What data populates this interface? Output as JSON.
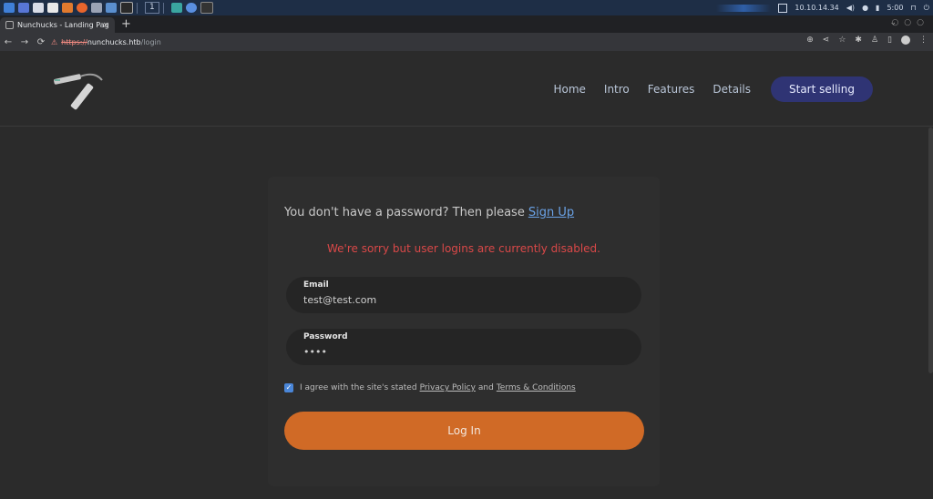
{
  "os_taskbar": {
    "workspace_number": "1",
    "status_text": "10.10.14.34",
    "clock": "5:00",
    "colors": {
      "bar": "#1e2e46"
    }
  },
  "browser": {
    "tab_title": "Nunchucks - Landing Pag",
    "tab_close": "×",
    "new_tab": "+",
    "url_scheme": "https://",
    "url_host": "nunchucks.htb",
    "url_path": "/login",
    "nav_back": "←",
    "nav_forward": "→",
    "nav_reload": "⟳"
  },
  "site": {
    "nav": {
      "home": "Home",
      "intro": "Intro",
      "features": "Features",
      "details": "Details",
      "cta": "Start selling"
    },
    "login": {
      "signup_prompt": "You don't have a password? Then please",
      "signup_link": "Sign Up",
      "error": "We're sorry but user logins are currently disabled.",
      "email_label": "Email",
      "email_value": "test@test.com",
      "password_label": "Password",
      "password_value": "••••",
      "agree_text": "I agree with the site's stated",
      "privacy_link": "Privacy Policy",
      "and_text": "and",
      "terms_link": "Terms & Conditions",
      "agree_checked": true,
      "submit": "Log In"
    },
    "colors": {
      "background": "#2b2b2b",
      "cta": "#2f3474",
      "error": "#d94848",
      "submit": "#d06a26",
      "link": "#6aa2e6"
    }
  }
}
